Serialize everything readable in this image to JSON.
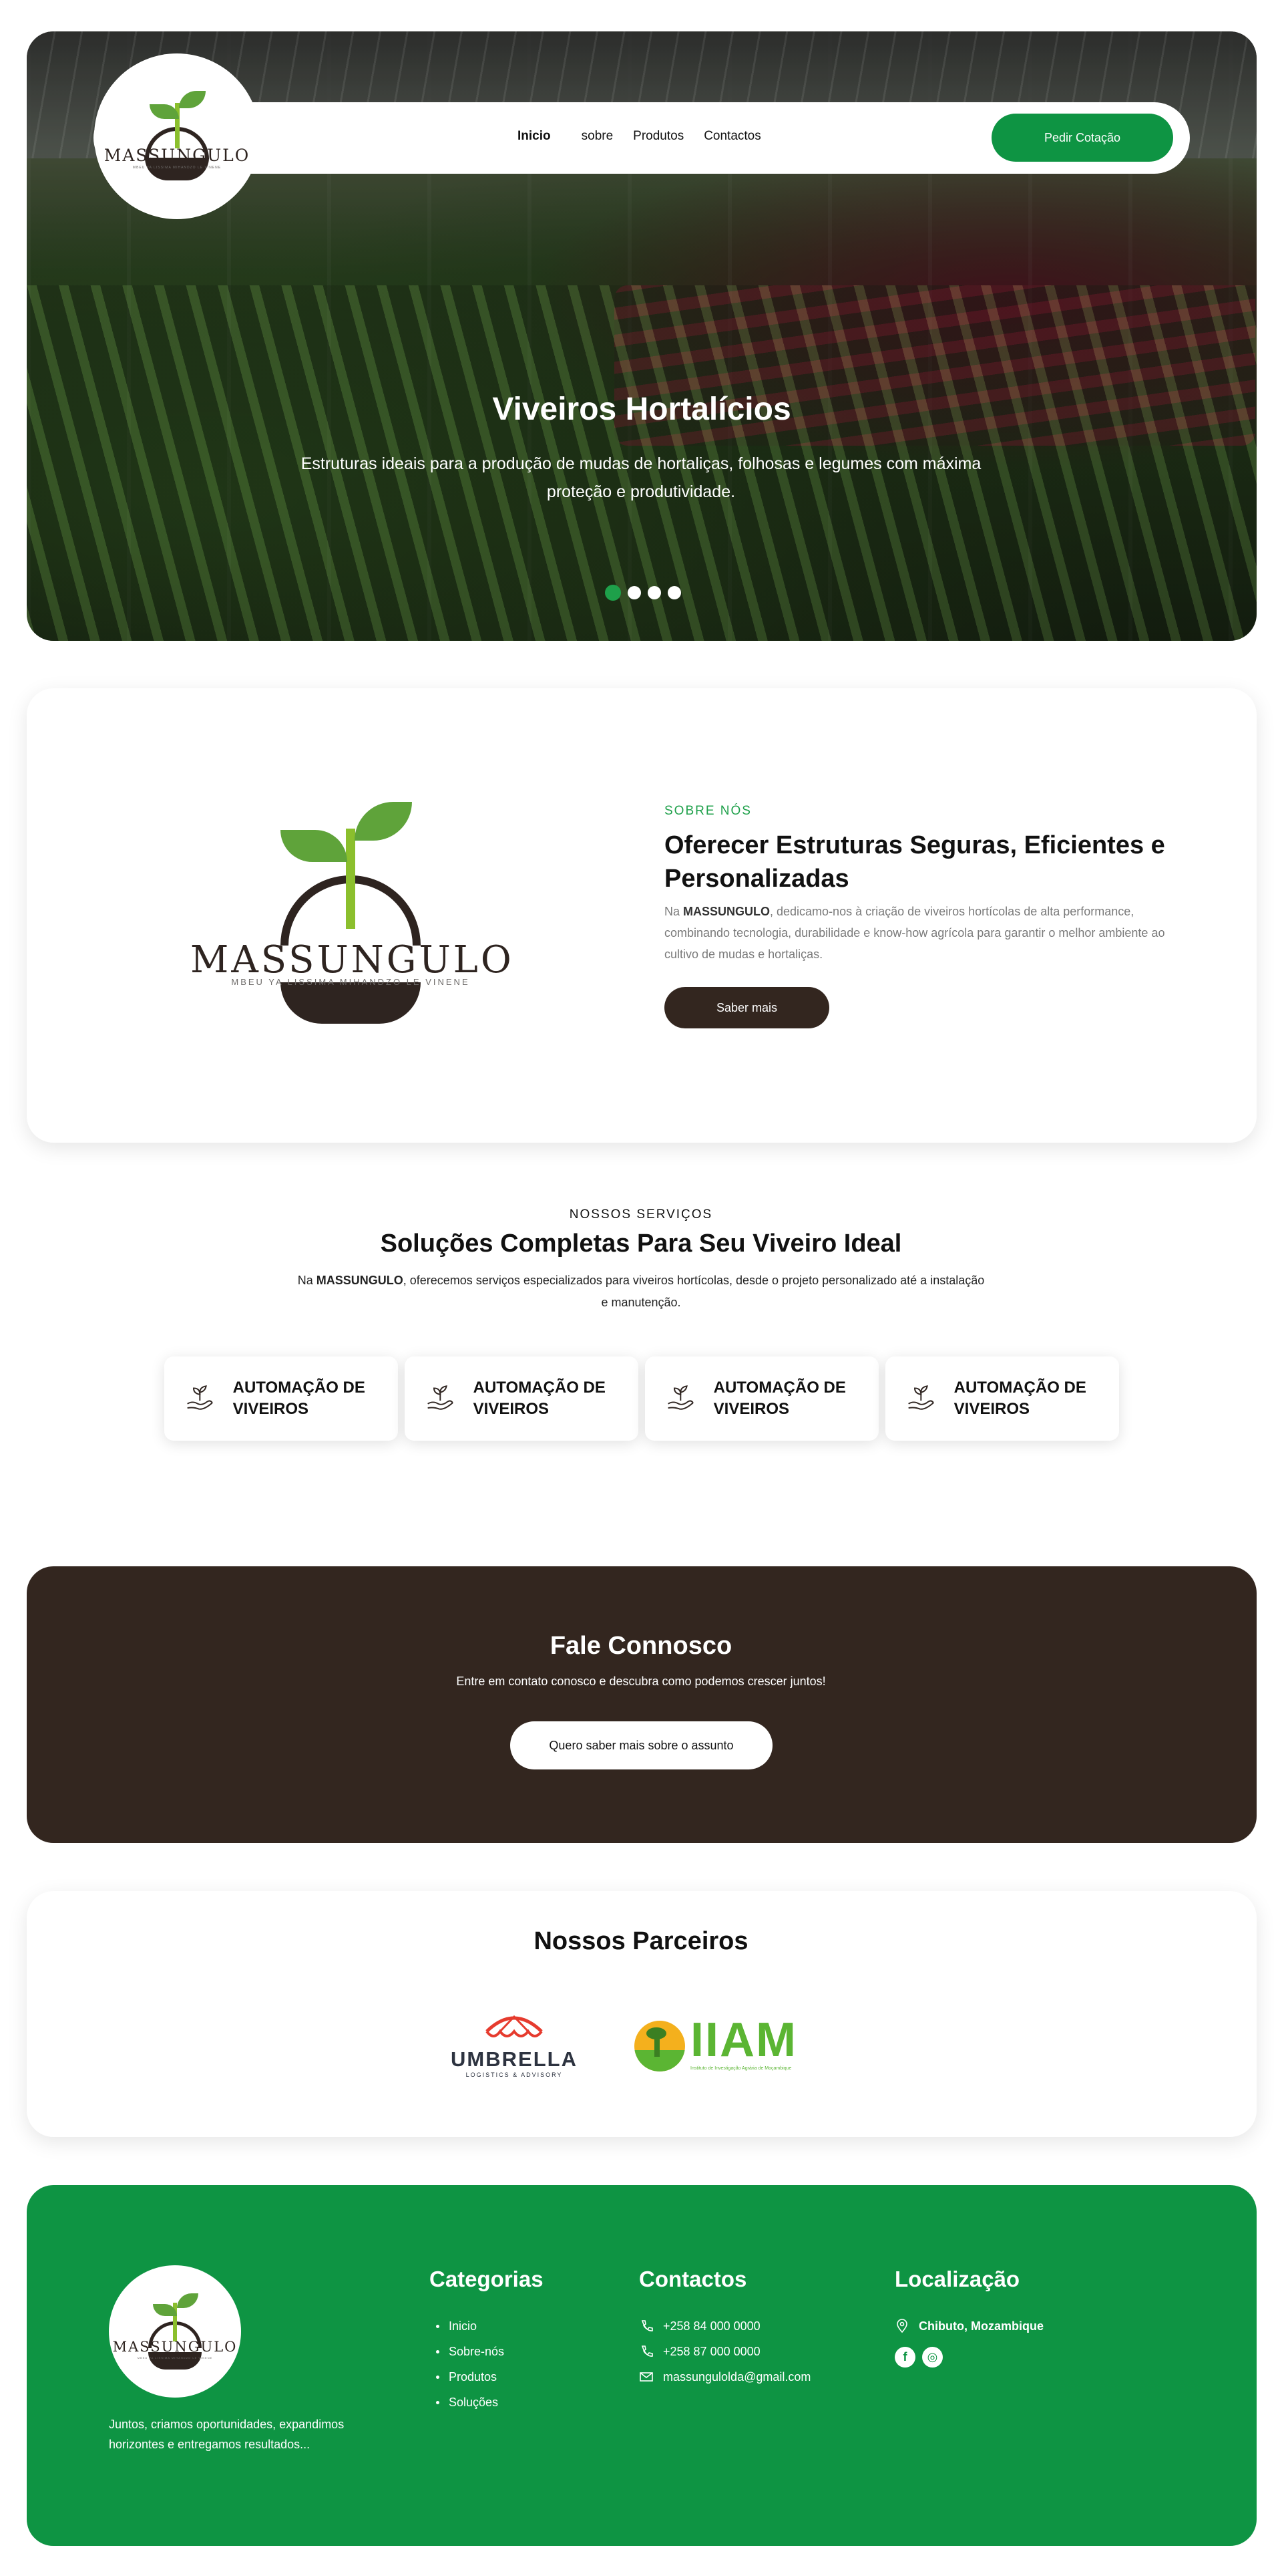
{
  "brand": {
    "name": "MASSUNGULO",
    "tagline": "MBEU YA LISSIMA MIHANDZO LE VINENE"
  },
  "nav": {
    "items": [
      "Inicio",
      "sobre",
      "Produtos",
      "Contactos"
    ],
    "active": "Inicio",
    "cta": "Pedir Cotação"
  },
  "hero": {
    "title": "Viveiros Hortalícios",
    "subtitle": "Estruturas ideais para a produção de mudas de hortaliças, folhosas e legumes com máxima proteção e produtividade.",
    "slides": 4,
    "active_slide": 1
  },
  "about": {
    "eyebrow": "SOBRE NÓS",
    "title": "Oferecer Estruturas Seguras, Eficientes e Personalizadas",
    "text_prefix": "Na ",
    "text_brand": "MASSUNGULO",
    "text_rest": ", dedicamo-nos à criação de viveiros hortícolas de alta performance, combinando tecnologia, durabilidade e know-how agrícola para garantir o melhor ambiente ao cultivo de mudas e hortaliças.",
    "button": "Saber mais"
  },
  "services": {
    "eyebrow": "NOSSOS SERVIÇOS",
    "title": "Soluções Completas Para Seu Viveiro Ideal",
    "text_prefix": "Na ",
    "text_brand": "MASSUNGULO",
    "text_rest": ", oferecemos serviços especializados para viveiros hortícolas, desde o projeto personalizado até a instalação e manutenção.",
    "cards": [
      {
        "label": "AUTOMAÇÃO DE VIVEIROS",
        "icon": "plant-hand-icon"
      },
      {
        "label": "AUTOMAÇÃO DE VIVEIROS",
        "icon": "plant-hand-icon"
      },
      {
        "label": "AUTOMAÇÃO DE VIVEIROS",
        "icon": "plant-hand-icon"
      },
      {
        "label": "AUTOMAÇÃO DE VIVEIROS",
        "icon": "plant-hand-icon"
      }
    ]
  },
  "contact": {
    "title": "Fale Connosco",
    "subtitle": "Entre em contato conosco e descubra como podemos crescer juntos!",
    "button": "Quero saber mais sobre o assunto"
  },
  "partners": {
    "title": "Nossos Parceiros",
    "umbrella": {
      "name": "UMBRELLA",
      "sub": "LOGISTICS & ADVISORY"
    },
    "iiam": {
      "name": "IIAM",
      "sub": "Instituto de Investigação Agrária de Moçambique"
    }
  },
  "footer": {
    "tagline": "Juntos, criamos oportunidades, expandimos horizontes e entregamos resultados...",
    "categories_title": "Categorias",
    "categories": [
      "Inicio",
      "Sobre-nós",
      "Produtos",
      "Soluções"
    ],
    "contacts_title": "Contactos",
    "phones": [
      "+258 84 000 0000",
      "+258 87 000 0000"
    ],
    "email": "massungulolda@gmail.com",
    "location_title": "Localização",
    "location": "Chibuto, Mozambique",
    "social": [
      "facebook-icon",
      "instagram-icon"
    ]
  },
  "colors": {
    "green": "#0e9443",
    "brown": "#33261f",
    "leaf": "#5fa33a",
    "accent": "#1ea04a"
  }
}
